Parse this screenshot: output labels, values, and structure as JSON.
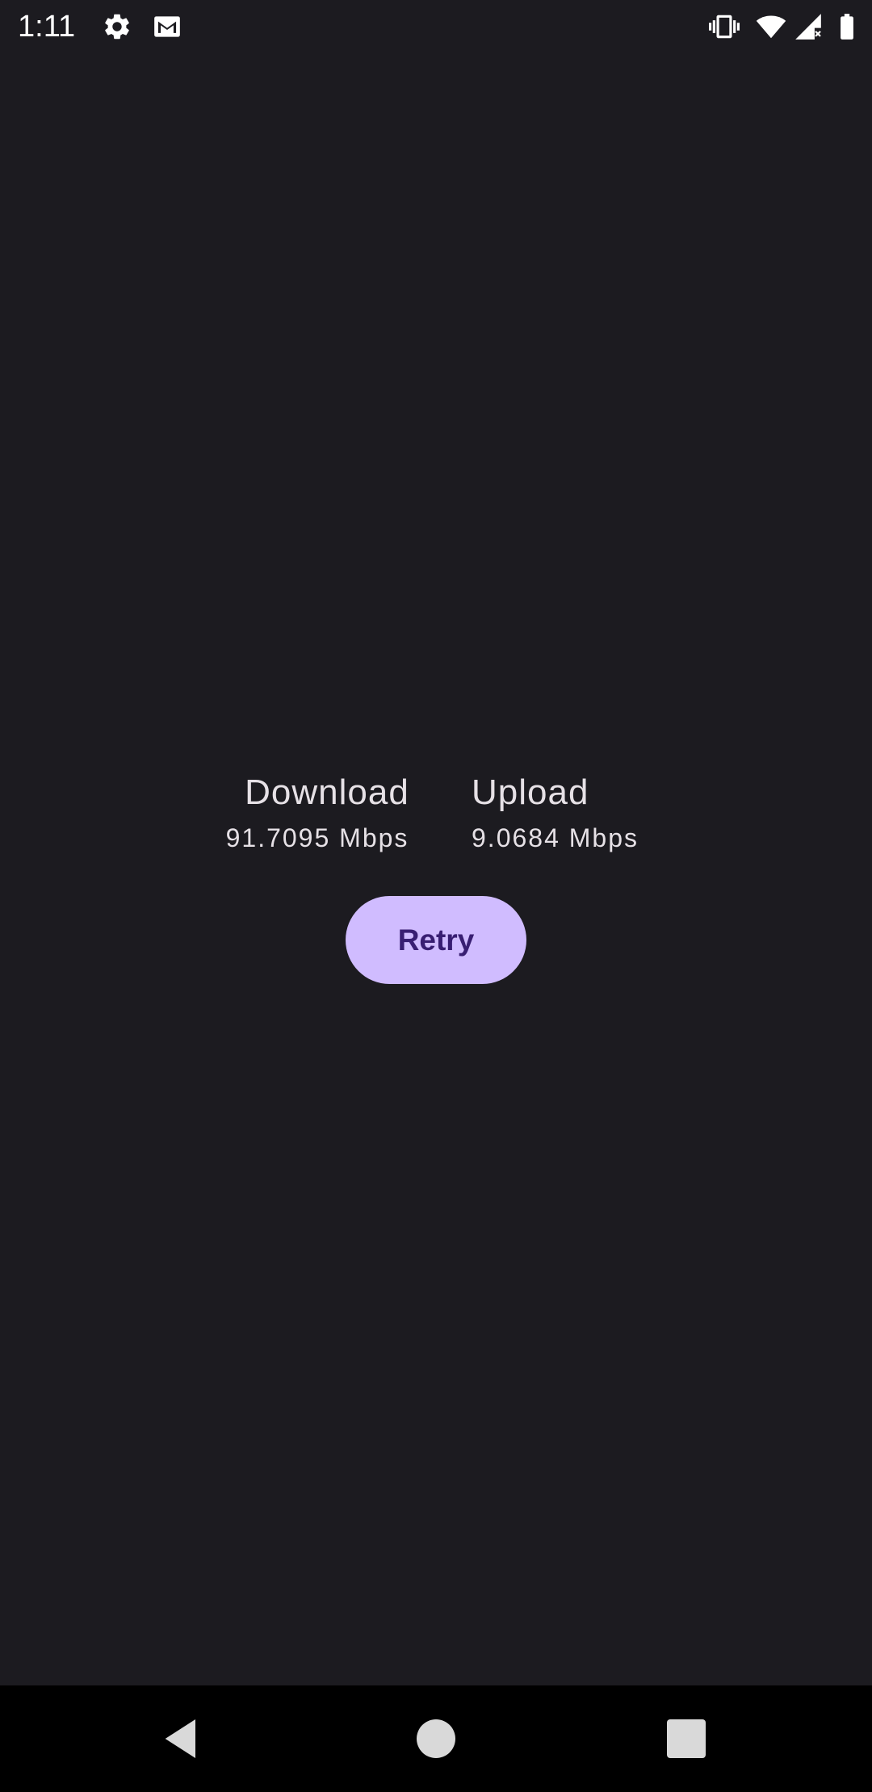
{
  "status_bar": {
    "time": "1:11",
    "left_icons": [
      "settings-icon",
      "gmail-icon"
    ],
    "right_icons": [
      "vibrate-icon",
      "wifi-icon",
      "cellular-no-signal-icon",
      "battery-icon"
    ]
  },
  "results": {
    "download": {
      "label": "Download",
      "value": "91.7095 Mbps"
    },
    "upload": {
      "label": "Upload",
      "value": "9.0684 Mbps"
    }
  },
  "retry_button": {
    "label": "Retry"
  },
  "navigation": {
    "buttons": [
      "back-icon",
      "home-icon",
      "recents-icon"
    ]
  },
  "colors": {
    "background": "#1c1b20",
    "button_bg": "#d0bcff",
    "button_text": "#381e72",
    "text": "#e6e1e6",
    "nav_bar": "#000000"
  }
}
